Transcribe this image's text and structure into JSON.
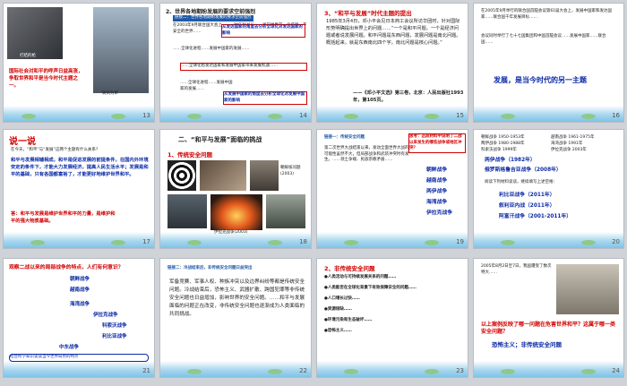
{
  "pages": [
    "13",
    "14",
    "15",
    "16",
    "17",
    "18",
    "19",
    "20",
    "21",
    "22",
    "23",
    "24"
  ],
  "s13": {
    "photo1_caption": "打结的枪",
    "photo2_caption": "铸剑为犁",
    "text": "国际社会对和平的呼声日益高涨，争取世界和平是当今时代主题之一。"
  },
  "s14": {
    "title": "2、世界各地期盼发展的要求空前强烈",
    "subtitle": "链接二：世界各地期盼发展的要求空前强烈",
    "body1": "在2003年9月联合国大会上，……时任秘书长……当前世界是一个贫困、不安全的世界……",
    "bubble1": "从发达国家的角度去分析全球化对发达国家的影响",
    "body2": "……全球化进程……发展中国家的发展……",
    "bubble2": "从发达国家的角度去分析全球化对发展中国家的影响",
    "box_text": "……全球化给发达国家和发展中国家带来发展机遇……",
    "bubble3": "从发展中国家的角度去分析全球化对发展中国家的影响"
  },
  "s15": {
    "heading": "3、“和平与发展”时代主题的提出",
    "body": "1985年3月4日，邓小平会见日本商工会议所访华团时，针对国际形势明确提出世界上的问题……“一个是和平问题，一个是经济问题或者说发展问题。和平问题是东西问题，发展问题是南北问题。概括起来，就是东西南北四个字。南北问题是核心问题。”",
    "source": "——《邓小平文选》第三卷，北京：人民出版社1993年，第105页。"
  },
  "s16": {
    "body": "在2005年9月举行的联合国首脑会议第61届大会上，发展中国家和发达国家……联合国千年发展目标……",
    "body2": "会议同时举行了七十七国集团和中国首脑会议……发展中国家……联合国……",
    "highlight": "发展，是当今时代的另一主题"
  },
  "s17": {
    "title": "说一说",
    "q": "在今天，“和平”与“发展”这两个主题有什么关系?",
    "a1": "和平与发展相辅相成，和平是促进发展的前提条件，在国内外环境安定的条件下，才能大力发展经济，提高人民生活水平；发展是和平的基础，只有各国都富裕了，才能更好地维护世界和平。",
    "a2": "答：和平与发展是维护世界和平的力量，是维护和平的强大物质基础。"
  },
  "s18": {
    "heading": "二、“和平与发展”面临的挑战",
    "sub": "1、传统安全问题",
    "cap1": "印度洋海啸(2004)",
    "cap2": "伊拉克战争(2003)",
    "cap3": "朝鲜核问题(2003)",
    "cap4": "美伊战争"
  },
  "s19": {
    "tag": "链接一：传统安全问题",
    "body": "第二次世界大战结束以来，发动全面世界大战的可能性虽然不大，但局部战争和武装冲突时有发生。……领土争端、民族宗教矛盾……",
    "think": "思考：这段材料中说明了二战以来发生的哪些战争或地区冲突？",
    "wars": [
      "朝鲜战争",
      "越南战争",
      "两伊战争",
      "海湾战争",
      "伊拉克战争"
    ]
  },
  "s20": {
    "items": [
      "朝鲜战争 1950-1953年",
      "越南战争 1961-1975年",
      "两伊战争 1980-1988年",
      "海湾战争 1991年",
      "科索沃战争 1999年",
      "伊拉克战争 2003年"
    ],
    "hl": [
      "两伊战争（1982年）",
      "俄罗斯格鲁吉亚战争（2008年）"
    ],
    "sub": "阅读下列材料谈谈，继续填写上述空格：",
    "more": [
      "利比亚战争（2011年）",
      "叙利亚内战（2011年）",
      "阿富汗战争（2001-2011年）"
    ]
  },
  "s21": {
    "heading": "观察二战以来的局部战争的特点，人们有何意识？",
    "rows": [
      "朝鲜战争",
      "越南战争",
      "海湾战争",
      "伊拉克战争",
      "科索沃战争",
      "利比亚战争",
      "中东战争"
    ],
    "foot": "结合所学知识谈谈当今世界局势的特点"
  },
  "s22": {
    "tag": "链接二：冷战结束后，非传统安全问题日益突出",
    "body": "军备竞赛、军事人权、种族冲突以及边界纠纷等都是传统安全问题。冷战结束后，恐怖主义、武器扩散、跨国犯罪等非传统安全问题也日益增加，影响世界的安全问题。……和平与发展面临的问题正在改变，非传统安全问题也逐渐成为人类面临的共同挑战。"
  },
  "s23": {
    "heading": "2、非传统安全问题",
    "items": [
      "●人类活动与可持续发展关系的问题……",
      "●人类能否在全球化背景下有效保障安全的问题……",
      "●人口增长过快……",
      "●资源短缺……",
      "●环境污染和生态破坏……",
      "●恐怖主义……"
    ]
  },
  "s24": {
    "body": "2005年8月2日至7日，我国遭受了数次特大……",
    "q": "以上案例反映了哪一问题在危害世界和平？这属于哪一类安全问题？",
    "a": "恐怖主义；非传统安全问题"
  },
  "colors": {
    "accent_red": "#d10000",
    "accent_blue": "#0b2aa6",
    "slide_bg": "#ffffff",
    "water": "#7fc3e6"
  }
}
